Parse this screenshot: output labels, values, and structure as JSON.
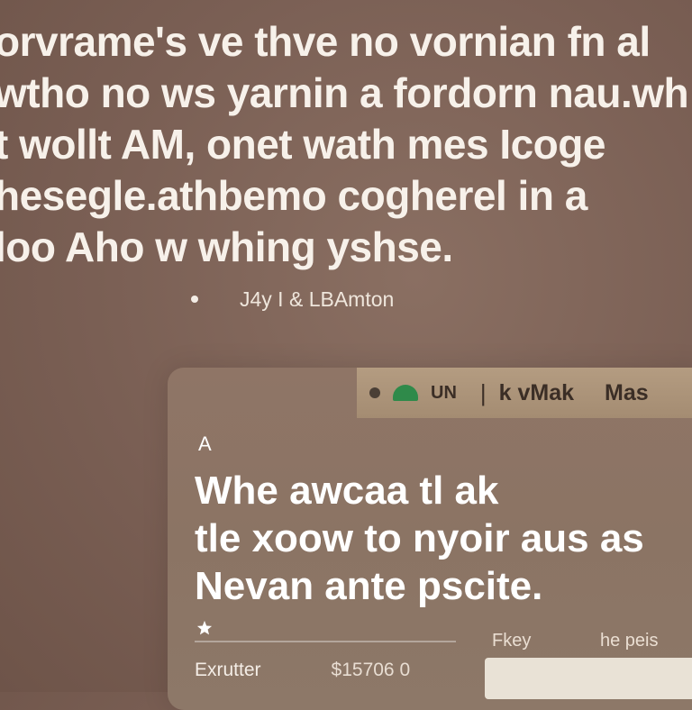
{
  "headline": {
    "lines": [
      "orvrame's ve thve no vornian fn al",
      "wtho no ws yarnin a fordorn nau.wh",
      "t wollt AM, onet wath mes Icoge",
      "hesegle.athbemo cogherel in a",
      "loo Aho w whing yshse."
    ]
  },
  "meta": {
    "byline": "J4y I & LBAmton"
  },
  "card": {
    "top_bar": {
      "unit_label": "UN",
      "sep": "|",
      "k_label": "k vMak",
      "master_label": "Mas"
    },
    "small_label": "A",
    "heading_lines": [
      "Whe awcaa tl ak",
      "tle xoow to nyoir aus as",
      "Nevan ante pscite."
    ],
    "fkey_label": "Fkey",
    "paid_label": "he peis",
    "export_label": "Exrutter",
    "amount": "$15706 0"
  }
}
